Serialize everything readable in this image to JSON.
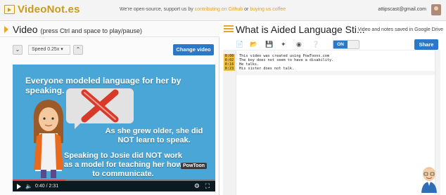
{
  "brand": {
    "name": "VideoNot.es"
  },
  "topbar": {
    "oss_prefix": "We're open-source, support us by",
    "github_link": "contributing on Github",
    "or_text": "or",
    "coffee_link": "buying us coffee",
    "account_email": "attipscast@gmail.com"
  },
  "video_panel": {
    "title": "Video",
    "title_hint": "(press Ctrl and space to play/pause)",
    "speed_label": "Speed",
    "speed_value": "0.25x",
    "change_video_label": "Change video",
    "slide": {
      "line1": "Everyone modeled language for her by speaking.",
      "line2": "As she grew older, she did NOT learn to speak.",
      "line3": "Speaking to Josie did NOT work as a model for teaching her how to communicate.",
      "watermark": "PowToon"
    },
    "controls": {
      "time_current": "0:40",
      "time_total": "2:31",
      "time_display": "0:40 / 2:31",
      "progress_fraction": 0.26
    }
  },
  "notes_panel": {
    "title": "What is Aided Language Sti...",
    "saved_status": "Video and notes saved in Google Drive",
    "sync_toggle": "ON",
    "share_label": "Share",
    "lines": [
      {
        "time": "0:00",
        "text": "This video was created using PowToons.com"
      },
      {
        "time": "0:02",
        "text": "The boy does not seem to have a disability."
      },
      {
        "time": "0:16",
        "text": "He talks."
      },
      {
        "time": "0:23",
        "text": "His sister does not talk."
      }
    ]
  },
  "colors": {
    "brand_gold": "#c99a1b",
    "accent_orange": "#e8a42c",
    "button_blue": "#2b78c9",
    "video_bg": "#4aa6d6",
    "progress_red": "#d93a3a",
    "timestamp_bg": "#f0c040"
  }
}
